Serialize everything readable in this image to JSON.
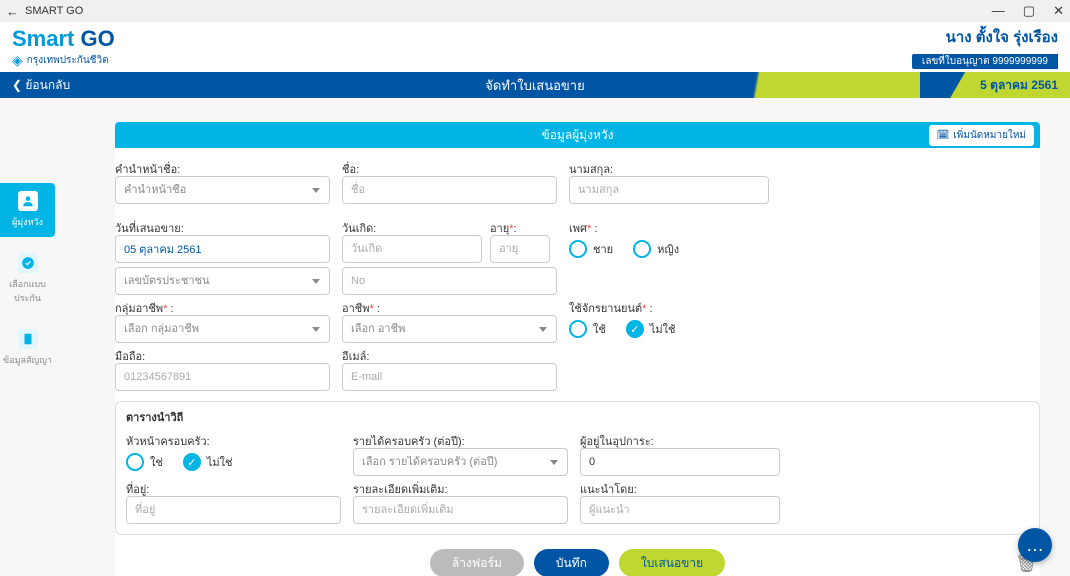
{
  "window": {
    "app_name": "SMART GO",
    "min": "—",
    "max": "▢",
    "close": "✕"
  },
  "brand": {
    "smart": "Smart",
    "go": " GO",
    "company": "กรุงเทพประกันชีวิต"
  },
  "agent": {
    "name": "นาง ตั้งใจ รุ่งเรือง",
    "license": "เลขที่ใบอนุญาต 9999999999"
  },
  "nav": {
    "back": "ย้อนกลับ",
    "title": "จัดทำใบเสนอขาย",
    "date": "5 ตุลาคม 2561"
  },
  "leftnav": {
    "prospect": "ผู้มุ่งหวัง",
    "plan": "เลือกแบบประกัน",
    "contract": "ข้อมูลสัญญา"
  },
  "section": {
    "title": "ข้อมูลผู้มุ่งหวัง",
    "new_appt": "เพิ่มนัดหมายใหม่"
  },
  "labels": {
    "prefix": "คำนำหน้าชื่อ:",
    "firstname": "ชื่อ:",
    "lastname": "นามสกุล:",
    "propose_date": "วันที่เสนอขาย:",
    "birthdate": "วันเกิด:",
    "age": "อายุ",
    "gender": "เพศ",
    "id_type": "",
    "occ_group": "กลุ่มอาชีพ",
    "occupation": "อาชีพ",
    "motorcycle": "ใช้จักรยานยนต์",
    "mobile": "มือถือ:",
    "email": "อีเมล์:",
    "lifestyle_title": "ตารางนำวิถี",
    "household_head": "หัวหน้าครอบครัว:",
    "household_income": "รายได้ครอบครัว (ต่อปี):",
    "dependents": "ผู้อยู่ในอุปการะ:",
    "address": "ที่อยู่:",
    "details": "รายละเอียดเพิ่มเติม:",
    "referrer": "แนะนำโดย:"
  },
  "placeholders": {
    "prefix": "คำนำหน้าชื่อ",
    "firstname": "ชื่อ",
    "lastname": "นามสกุล",
    "birthdate": "วันเกิด",
    "age": "อายุ",
    "id_type": "เลขบัตรประชาชน",
    "id_no": "No",
    "occ_group": "เลือก กลุ่มอาชีพ",
    "occupation": "เลือก อาชีพ",
    "mobile": "01234567891",
    "email": "E-mail",
    "household_income": "เลือก รายได้ครอบครัว (ต่อปี)",
    "address": "ที่อยู่",
    "details": "รายละเอียดเพิ่มเติม",
    "referrer": "ผู้แนะนำ"
  },
  "values": {
    "propose_date": "05 ตุลาคม 2561",
    "dependents": "0"
  },
  "options": {
    "male": "ชาย",
    "female": "หญิง",
    "yes": "ใช่",
    "no": "ไม่ใช่",
    "use": "ใช้",
    "not_use": "ไม่ใช้"
  },
  "buttons": {
    "clear": "ล้างฟอร์ม",
    "save": "บันทึก",
    "quote": "ใบเสนอขาย"
  },
  "fab": "…"
}
